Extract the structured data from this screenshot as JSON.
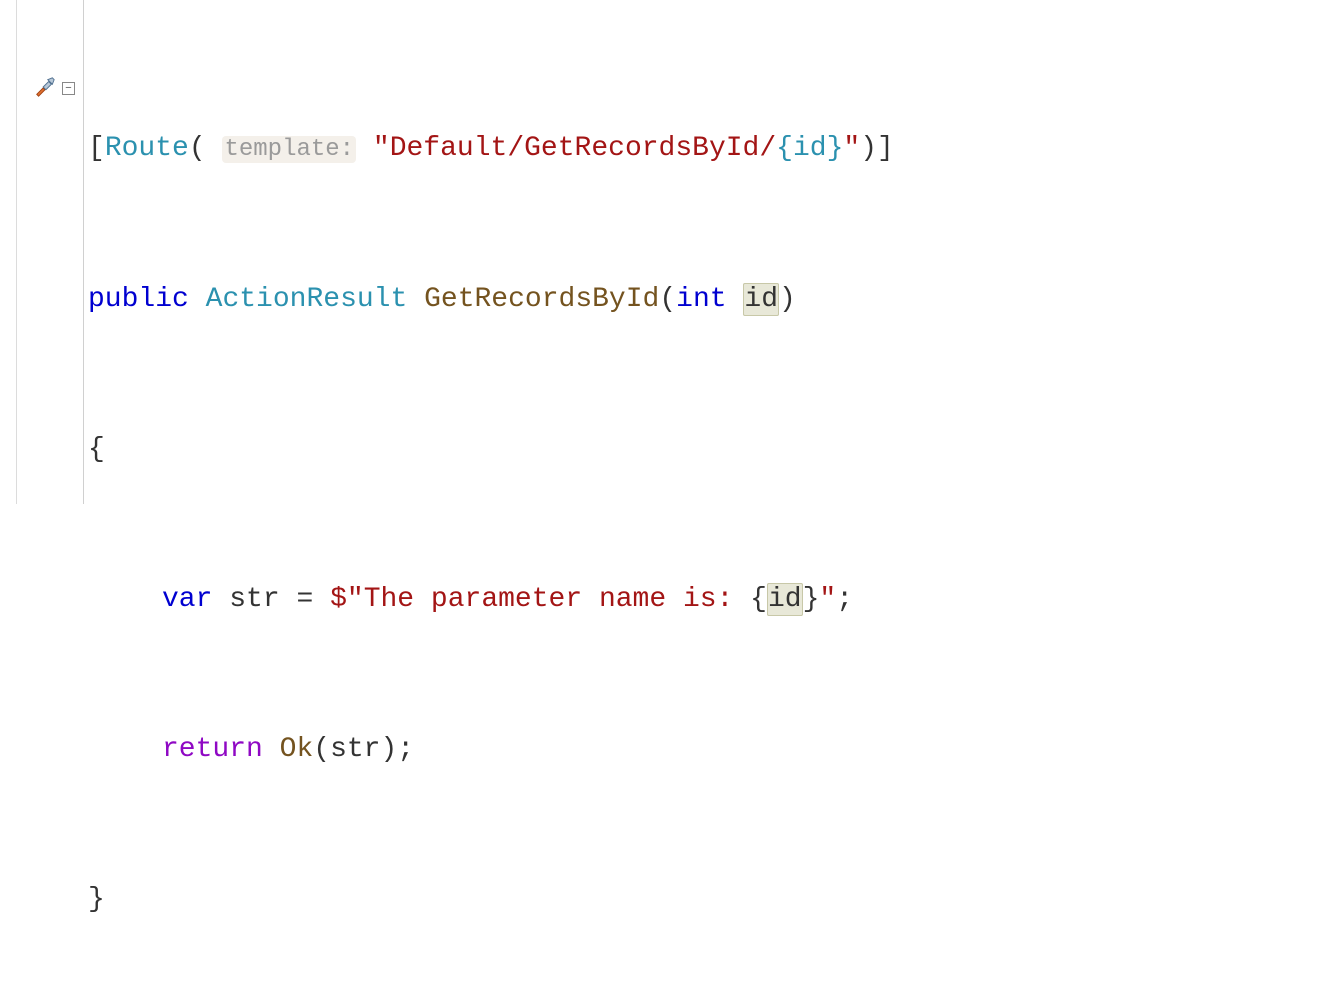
{
  "code": {
    "line1": {
      "open_bracket": "[",
      "attr": "Route",
      "paren_open": "(",
      "hint_label": "template:",
      "string_open": "\"",
      "string_path": "Default/GetRecordsById/",
      "interp_open": "{",
      "interp_id": "id",
      "interp_close": "}",
      "string_close": "\"",
      "paren_close": ")",
      "close_bracket": "]"
    },
    "line2": {
      "kw_public": "public",
      "type": "ActionResult",
      "method": "GetRecordsById",
      "paren_open": "(",
      "kw_int": "int",
      "param": "id",
      "paren_close": ")"
    },
    "line3": {
      "brace": "{"
    },
    "line4": {
      "kw_var": "var",
      "ident": "str",
      "op_eq": " = ",
      "dollar": "$",
      "string_open": "\"",
      "string_text": "The parameter name is: ",
      "interp_open": "{",
      "interp_id": "id",
      "interp_close": "}",
      "string_close": "\"",
      "semi": ";"
    },
    "line5": {
      "kw_return": "return",
      "method": "Ok",
      "paren_open": "(",
      "arg": "str",
      "paren_close": ")",
      "semi": ";"
    },
    "line6": {
      "brace": "}"
    }
  },
  "gutter": {
    "fold_symbol": "−"
  }
}
